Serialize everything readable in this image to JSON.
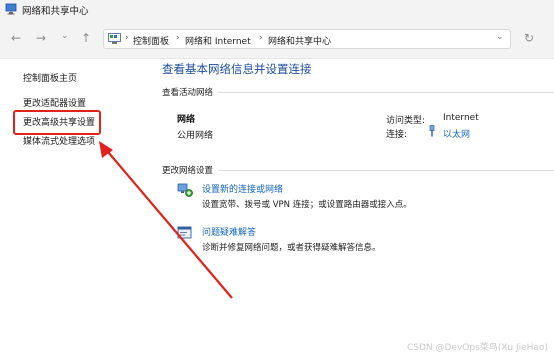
{
  "window": {
    "title": "网络和共享中心"
  },
  "nav": {
    "breadcrumbs": [
      "控制面板",
      "网络和 Internet",
      "网络和共享中心"
    ]
  },
  "sidebar": {
    "items": [
      {
        "label": "控制面板主页"
      },
      {
        "label": "更改适配器设置"
      },
      {
        "label": "更改高级共享设置"
      },
      {
        "label": "媒体流式处理选项"
      }
    ]
  },
  "main": {
    "heading": "查看基本网络信息并设置连接",
    "active_networks_label": "查看活动网络",
    "network": {
      "name": "网络",
      "type": "公用网络",
      "access_type_label": "访问类型:",
      "access_type_value": "Internet",
      "connections_label": "连接:",
      "connection_value": "以太网"
    },
    "change_settings_label": "更改网络设置",
    "settings": [
      {
        "title": "设置新的连接或网络",
        "desc": "设置宽带、拨号或 VPN 连接；或设置路由器或接入点。",
        "icon": "network-setup-icon"
      },
      {
        "title": "问题疑难解答",
        "desc": "诊断并修复网络问题，或者获得疑难解答信息。",
        "icon": "troubleshoot-icon"
      }
    ]
  },
  "annotation": {
    "highlight_color": "#e0221b"
  },
  "watermark": "CSDN @DevOps菜鸟(Xu JieHao)"
}
